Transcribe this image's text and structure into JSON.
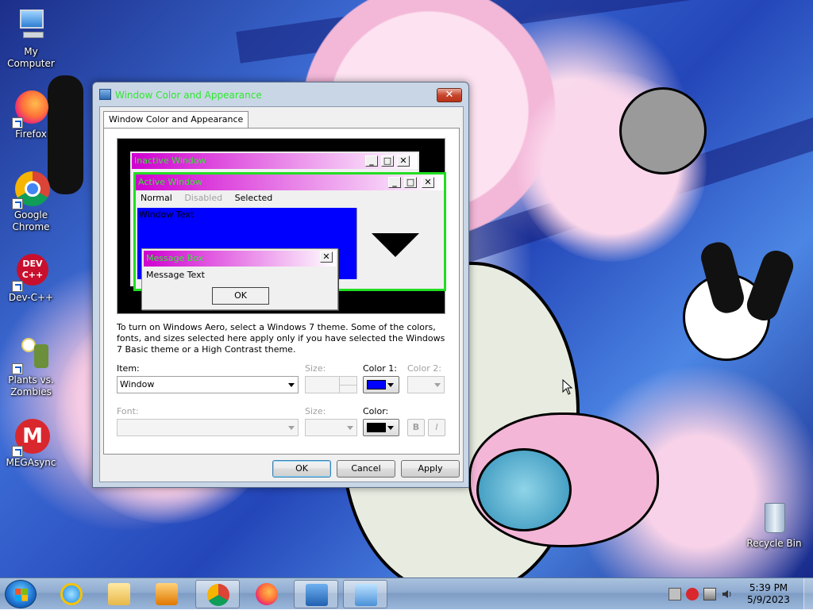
{
  "desktop": {
    "icons": [
      {
        "label": "My Computer"
      },
      {
        "label": "Firefox"
      },
      {
        "label": "Google Chrome"
      },
      {
        "label": "Dev-C++"
      },
      {
        "label": "Plants vs. Zombies"
      },
      {
        "label": "MEGAsync"
      },
      {
        "label": "Recycle Bin"
      }
    ]
  },
  "dialog": {
    "title": "Window Color and Appearance",
    "close_glyph": "✕",
    "tab_label": "Window Color and Appearance",
    "preview": {
      "inactive_title": "Inactive Window",
      "active_title": "Active Window",
      "menu_normal": "Normal",
      "menu_disabled": "Disabled",
      "menu_selected": "Selected",
      "window_text": "Window Text",
      "msgbox_title": "Message Box",
      "msgbox_text": "Message Text",
      "msgbox_ok": "OK",
      "btn_min": "_",
      "btn_max": "□",
      "btn_close": "✕"
    },
    "description": "To turn on Windows Aero, select a Windows 7 theme.  Some of the colors, fonts, and sizes selected here apply only if you have selected the Windows 7 Basic theme or a High Contrast theme.",
    "item_label": "Item:",
    "item_value": "Window",
    "size_label": "Size:",
    "color1_label": "Color 1:",
    "color1_value": "#0000ff",
    "color2_label": "Color 2:",
    "font_label": "Font:",
    "font_size_label": "Size:",
    "font_color_label": "Color:",
    "font_color_value": "#000000",
    "bold_label": "B",
    "italic_label": "I",
    "ok_label": "OK",
    "cancel_label": "Cancel",
    "apply_label": "Apply"
  },
  "taskbar": {
    "pinned": [
      "start-button",
      "internet-explorer-icon",
      "windows-explorer-icon",
      "media-player-icon",
      "chrome-icon",
      "firefox-icon",
      "display-settings-icon",
      "control-panel-icon"
    ],
    "clock_time": "5:39 PM",
    "clock_date": "5/9/2023"
  },
  "colors": {
    "active_border": "#22dd22",
    "title_text": "#36e636",
    "window_bg": "#0000ff",
    "title_gradient_start": "#d000d0"
  }
}
